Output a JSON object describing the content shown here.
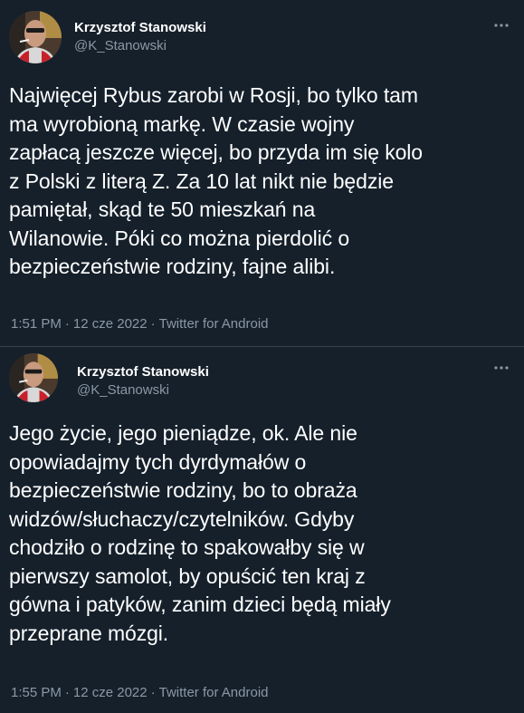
{
  "tweets": [
    {
      "author": {
        "display_name": "Krzysztof Stanowski",
        "handle": "@K_Stanowski"
      },
      "lines": [
        "Najwięcej Rybus zarobi w Rosji, bo tylko tam",
        "ma wyrobioną markę. W czasie wojny",
        "zapłacą jeszcze więcej, bo przyda im się kolo",
        "z Polski z literą Z. Za 10 lat nikt nie będzie",
        "pamiętał, skąd te 50 mieszkań na",
        "Wilanowie. Póki co można pierdolić o",
        "bezpieczeństwie rodziny, fajne alibi."
      ],
      "time": "1:51 PM",
      "date": "12 cze 2022",
      "source": "Twitter for Android",
      "separator": "·"
    },
    {
      "author": {
        "display_name": "Krzysztof Stanowski",
        "handle": "@K_Stanowski"
      },
      "lines": [
        "Jego życie, jego pieniądze, ok. Ale nie",
        "opowiadajmy tych dyrdymałów o",
        "bezpieczeństwie rodziny, bo to obraża",
        "widzów/słuchaczy/czytelników. Gdyby",
        "chodziło o rodzinę to spakowałby się w",
        "pierwszy samolot, by opuścić ten kraj z",
        "gówna i patyków, zanim dzieci będą miały",
        "przeprane mózgi."
      ],
      "time": "1:55 PM",
      "date": "12 cze 2022",
      "source": "Twitter for Android",
      "separator": "·"
    }
  ],
  "icons": {
    "more": "more-horizontal-icon"
  },
  "colors": {
    "background": "#15202b",
    "primary_text": "#ffffff",
    "secondary_text": "#8b98a5",
    "divider": "#38444d"
  }
}
